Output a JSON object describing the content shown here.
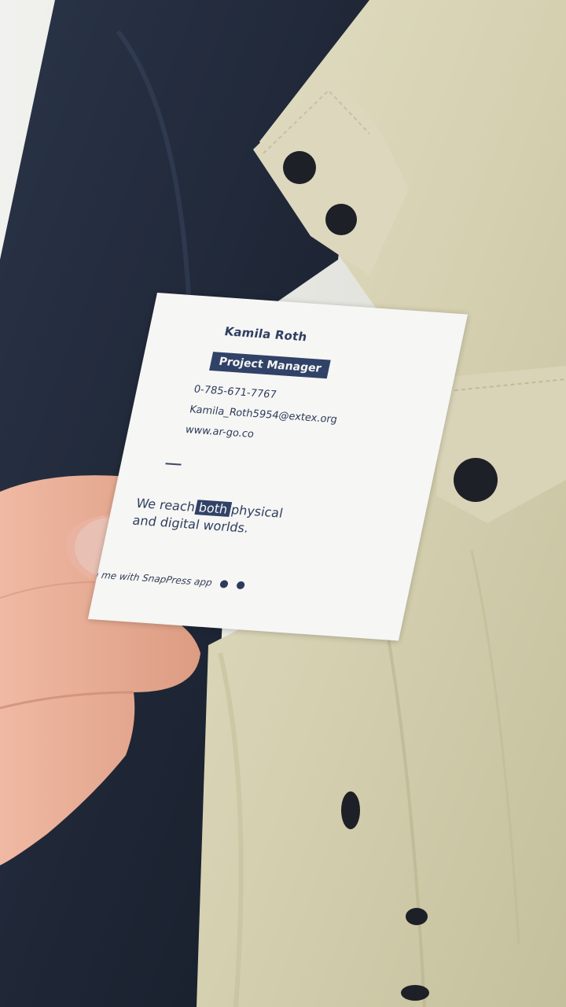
{
  "card": {
    "name": "Kamila Roth",
    "title": "Project Manager",
    "phone": "0-785-671-7767",
    "email": "Kamila_Roth5954@extex.org",
    "website": "www.ar-go.co",
    "tagline": {
      "before": "We reach",
      "highlight": "both",
      "after": "physical",
      "line2": "and digital worlds."
    },
    "scan_text": "n me with SnapPress app",
    "icons": [
      "android-icon",
      "apple-icon"
    ]
  },
  "colors": {
    "card_accent": "#314268",
    "card_paper": "#f6f6f4",
    "jacket": "#d6d2b3",
    "coat": "#1f2838",
    "skin": "#e8a890"
  }
}
